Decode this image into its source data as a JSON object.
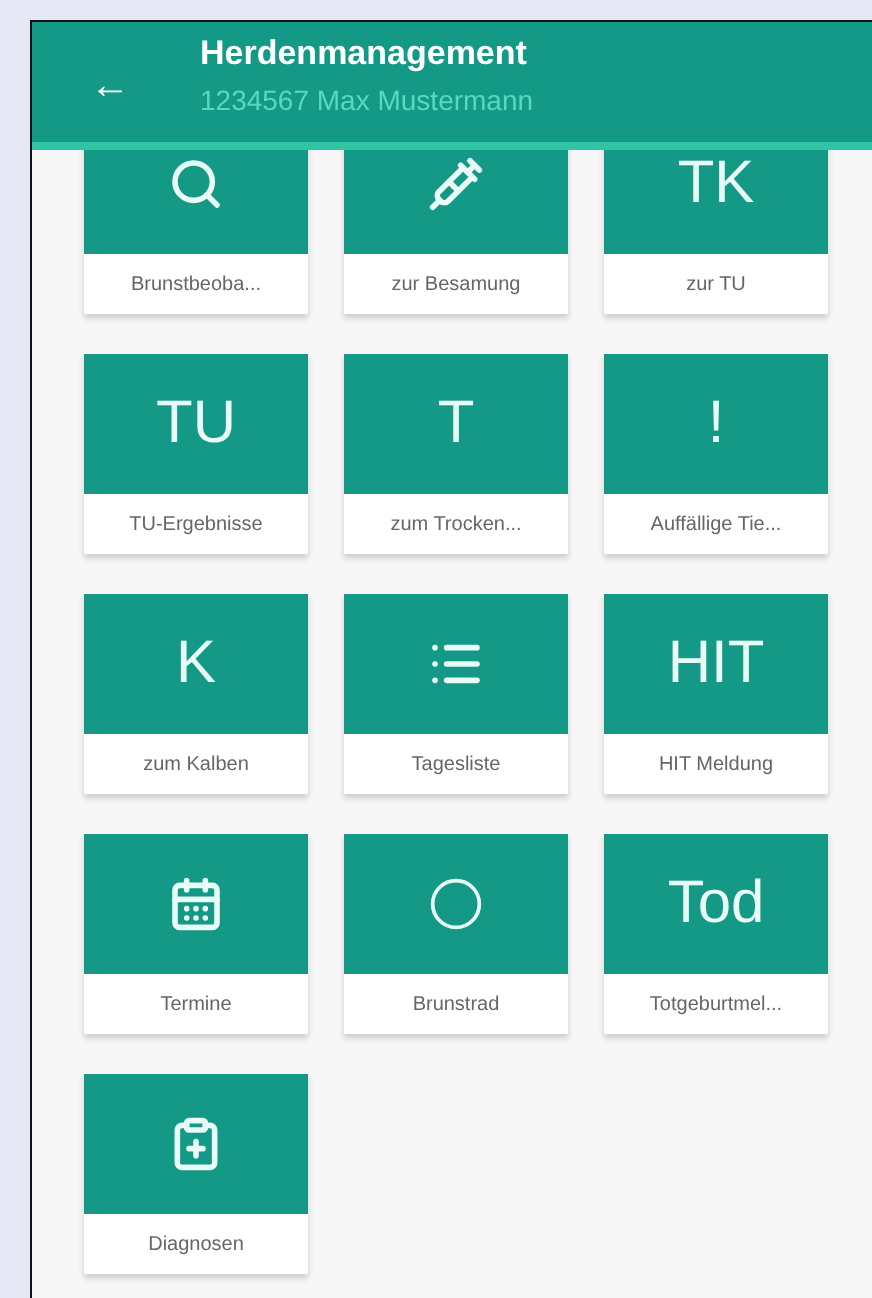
{
  "header": {
    "back": "←",
    "title": "Herdenmanagement",
    "subtitle": "1234567 Max Mustermann"
  },
  "tiles": [
    {
      "label": "Brunstbeoba...",
      "icon": {
        "kind": "search"
      }
    },
    {
      "label": "zur Besamung",
      "icon": {
        "kind": "syringe"
      }
    },
    {
      "label": "zur TU",
      "icon": {
        "kind": "text",
        "text": "TK"
      }
    },
    {
      "label": "TU-Ergebnisse",
      "icon": {
        "kind": "text",
        "text": "TU"
      }
    },
    {
      "label": "zum Trocken...",
      "icon": {
        "kind": "text",
        "text": "T"
      }
    },
    {
      "label": "Auffällige Tie...",
      "icon": {
        "kind": "text",
        "text": "!"
      }
    },
    {
      "label": "zum Kalben",
      "icon": {
        "kind": "text",
        "text": "K"
      }
    },
    {
      "label": "Tagesliste",
      "icon": {
        "kind": "list"
      }
    },
    {
      "label": "HIT Meldung",
      "icon": {
        "kind": "text",
        "text": "HIT"
      }
    },
    {
      "label": "Termine",
      "icon": {
        "kind": "calendar"
      }
    },
    {
      "label": "Brunstrad",
      "icon": {
        "kind": "circle"
      }
    },
    {
      "label": "Totgeburtmel...",
      "icon": {
        "kind": "text",
        "text": "Tod"
      }
    },
    {
      "label": "Diagnosen",
      "icon": {
        "kind": "clipboard"
      }
    }
  ]
}
